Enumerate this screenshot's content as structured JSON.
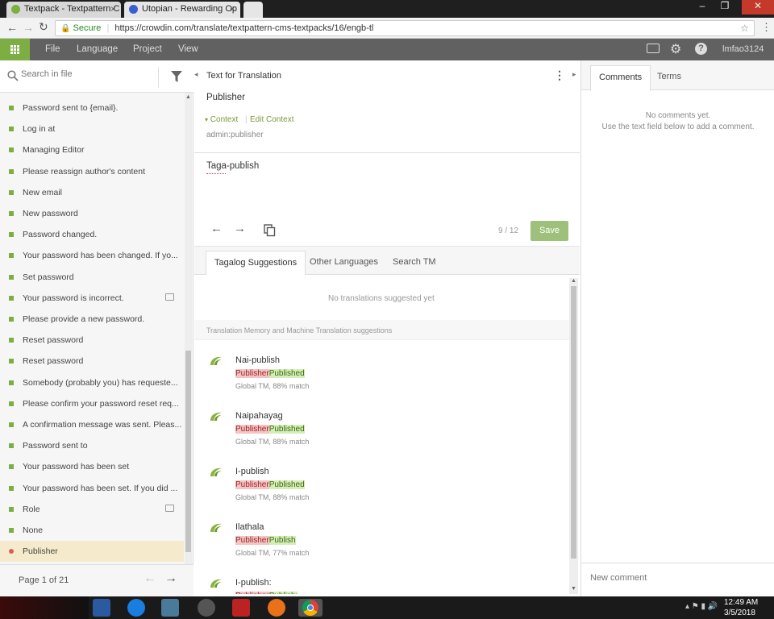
{
  "browser": {
    "tabs": [
      {
        "label": "Textpack - Textpattern C",
        "close": "×"
      },
      {
        "label": "Utopian - Rewarding Op",
        "close": "×"
      }
    ],
    "window_controls": [
      "–",
      "❐",
      "✕"
    ],
    "secure_label": "Secure",
    "url": "https://crowdin.com/translate/textpattern-cms-textpacks/16/engb-tl"
  },
  "app_toolbar": {
    "menu": [
      "File",
      "Language",
      "Project",
      "View"
    ],
    "username": "lmfao3124"
  },
  "left_panel": {
    "search_placeholder": "Search in file",
    "items": [
      {
        "label": "Password sent to {email}.",
        "comment": false
      },
      {
        "label": "Log in at",
        "comment": false
      },
      {
        "label": "Managing Editor",
        "comment": false
      },
      {
        "label": "Please reassign author's content",
        "comment": false
      },
      {
        "label": "New email",
        "comment": false
      },
      {
        "label": "New password",
        "comment": false
      },
      {
        "label": "Password changed.",
        "comment": false
      },
      {
        "label": "Your password has been changed. If yo...",
        "comment": false
      },
      {
        "label": "Set password",
        "comment": false
      },
      {
        "label": "Your password is incorrect.",
        "comment": true
      },
      {
        "label": "Please provide a new password.",
        "comment": false
      },
      {
        "label": "Reset password",
        "comment": false
      },
      {
        "label": "Reset password",
        "comment": false
      },
      {
        "label": "Somebody (probably you) has requeste...",
        "comment": false
      },
      {
        "label": "Please confirm your password reset req...",
        "comment": false
      },
      {
        "label": "A confirmation message was sent. Pleas...",
        "comment": false
      },
      {
        "label": "Password sent to",
        "comment": false
      },
      {
        "label": "Your password has been set",
        "comment": false
      },
      {
        "label": "Your password has been set. If you did ...",
        "comment": false
      },
      {
        "label": "Role",
        "comment": true
      },
      {
        "label": "None",
        "comment": false
      },
      {
        "label": "Publisher",
        "comment": false,
        "active": true
      }
    ],
    "pager": "Page 1 of 21"
  },
  "middle": {
    "header": "Text for Translation",
    "source_text": "Publisher",
    "context_label": "Context",
    "edit_context_label": "Edit Context",
    "context_value": "admin:publisher",
    "translation": "Taga-publish",
    "counter": "9 / 12",
    "save_label": "Save",
    "tabs": [
      "Tagalog Suggestions",
      "Other Languages",
      "Search TM"
    ],
    "no_suggestions": "No translations suggested yet",
    "tm_header": "Translation Memory and Machine Translation suggestions",
    "suggestions": [
      {
        "text": "Nai-publish",
        "del": "Publisher",
        "ins": "Published",
        "meta": "Global TM, 88% match"
      },
      {
        "text": "Naipahayag",
        "del": "Publisher",
        "ins": "Published",
        "meta": "Global TM, 88% match"
      },
      {
        "text": "I-publish",
        "del": "Publisher",
        "ins": "Published",
        "meta": "Global TM, 88% match"
      },
      {
        "text": "Ilathala",
        "del": "Publisher",
        "ins": "Publish",
        "meta": "Global TM, 77% match"
      },
      {
        "text": "I-publish:",
        "del": "Publisher",
        "ins": "Publish:",
        "meta": ""
      }
    ]
  },
  "right": {
    "tabs": [
      "Comments",
      "Terms"
    ],
    "empty_line1": "No comments yet.",
    "empty_line2": "Use the text field below to add a comment.",
    "new_comment_placeholder": "New comment"
  },
  "taskbar": {
    "time": "12:49 AM",
    "date": "3/5/2018"
  },
  "colors": {
    "accent_green": "#7cae43",
    "save_green": "#9ec07a",
    "toolbar_gray": "#616161",
    "active_row": "#f5ebcc"
  }
}
